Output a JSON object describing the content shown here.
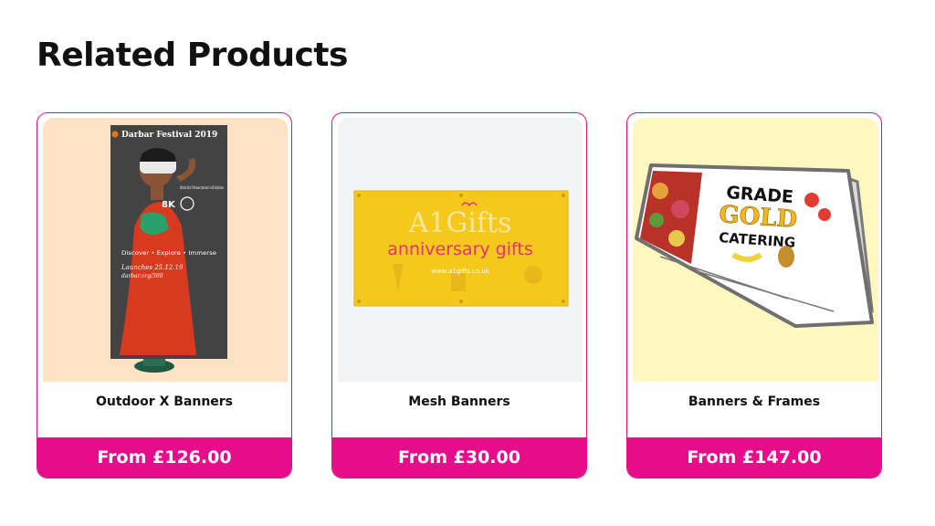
{
  "section": {
    "title": "Related Products"
  },
  "colors": {
    "accent": "#e70d8a",
    "border": "#d4147f"
  },
  "products": [
    {
      "name": "Outdoor X Banners",
      "price": "From £126.00",
      "image": {
        "bg": "#fde3c4",
        "heading": "Darbar Festival 2019",
        "tagline": "Worlds first Ultimate festival in 8K definition",
        "badge": "8K",
        "line1": "Discover • Explore • Immerse",
        "line2": "Launches 25.12.19",
        "line3": "darbar.org/360"
      }
    },
    {
      "name": "Mesh Banners",
      "price": "From £30.00",
      "image": {
        "bg": "#f1f3f4",
        "logo": "A1Gifts",
        "headline": "anniversary gifts",
        "url": "www.a1gifts.co.uk"
      }
    },
    {
      "name": "Banners & Frames",
      "price": "From £147.00",
      "image": {
        "bg": "#fef8c0",
        "line1": "GRADE",
        "line2": "GOLD",
        "line3": "CATERING"
      }
    }
  ]
}
